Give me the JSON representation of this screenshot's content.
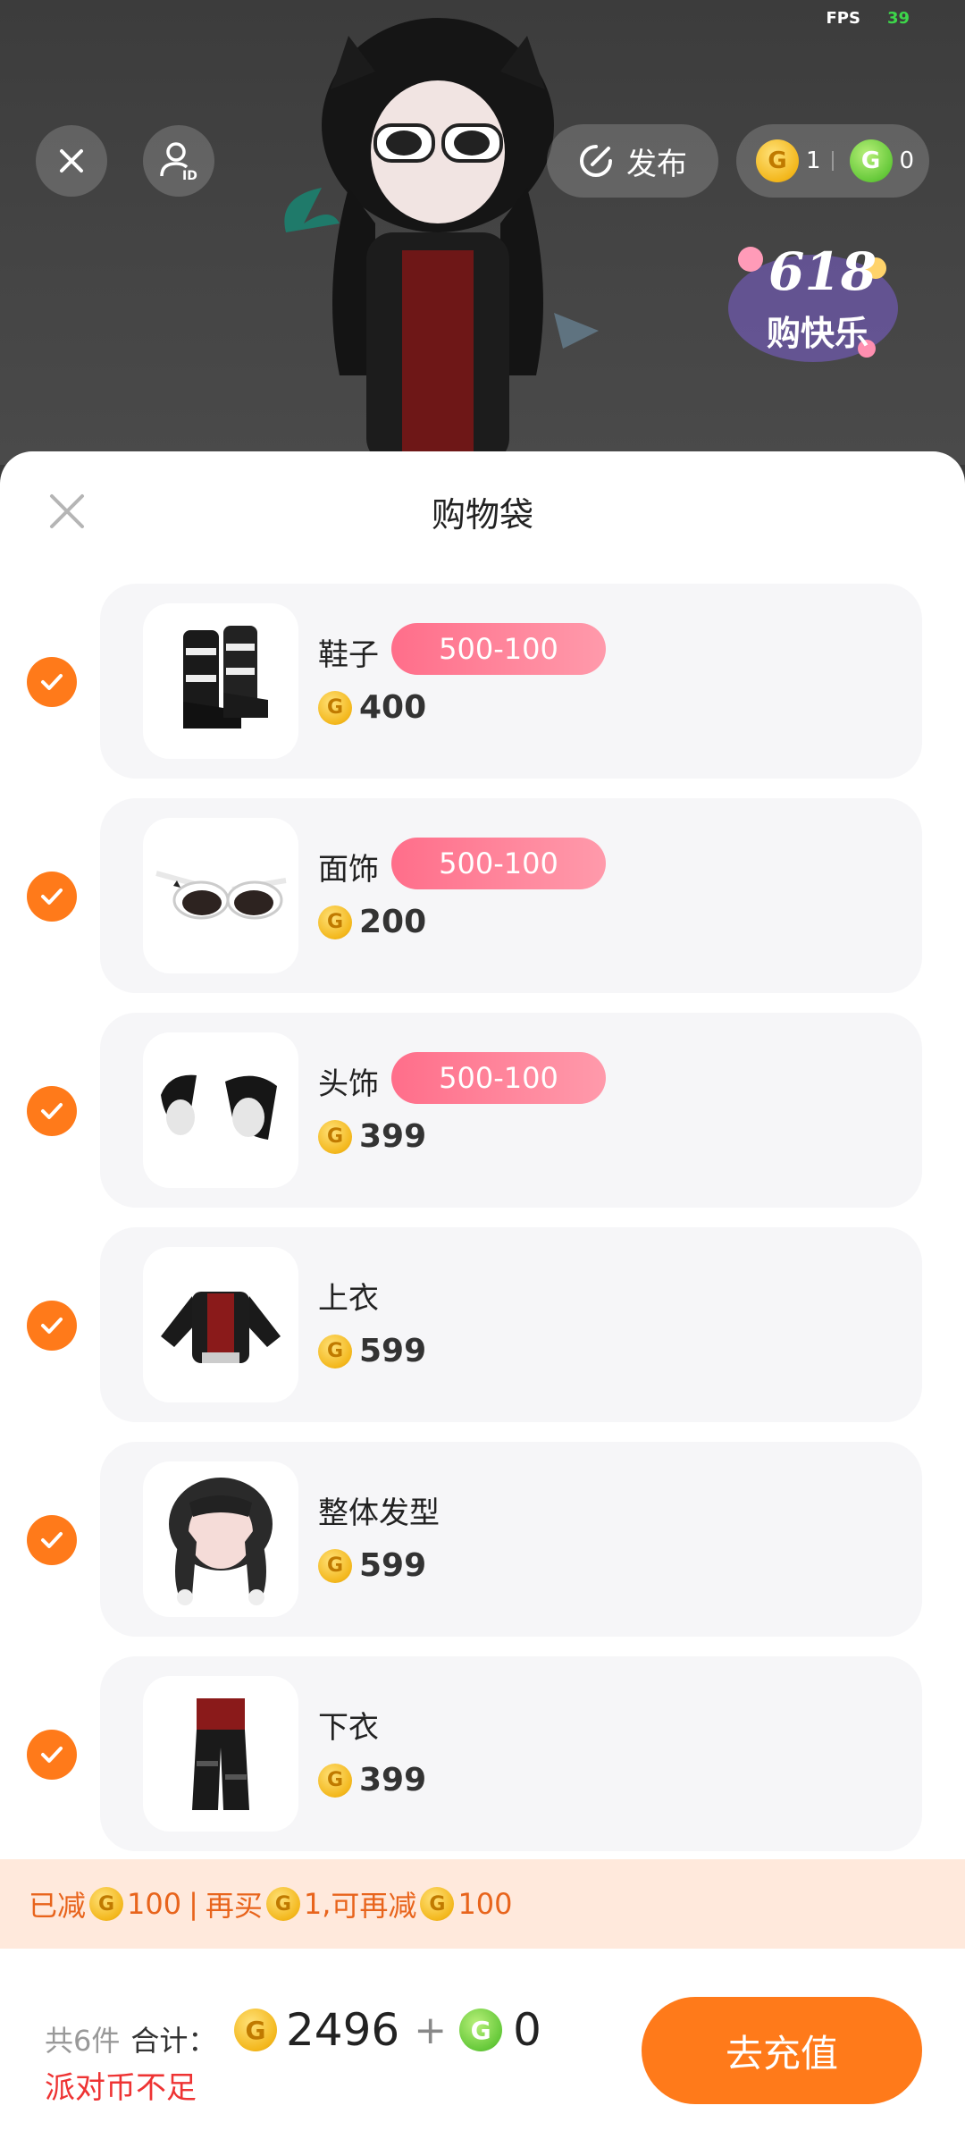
{
  "status": {
    "fps_label": "FPS",
    "fps_value": "39"
  },
  "top_bar": {
    "publish_label": "发布",
    "gold_coin_count": "1",
    "green_coin_count": "0",
    "promo_text_top": "618",
    "promo_text_bottom": "购快乐"
  },
  "sheet": {
    "title": "购物袋"
  },
  "items": [
    {
      "name": "鞋子",
      "tag": "500-100",
      "price": "400",
      "checked": true,
      "icon": "boots-icon"
    },
    {
      "name": "面饰",
      "tag": "500-100",
      "price": "200",
      "checked": true,
      "icon": "sunglasses-icon"
    },
    {
      "name": "头饰",
      "tag": "500-100",
      "price": "399",
      "checked": true,
      "icon": "ear-muffs-icon"
    },
    {
      "name": "上衣",
      "tag": "",
      "price": "599",
      "checked": true,
      "icon": "jacket-icon"
    },
    {
      "name": "整体发型",
      "tag": "",
      "price": "599",
      "checked": true,
      "icon": "hairstyle-icon"
    },
    {
      "name": "下衣",
      "tag": "",
      "price": "399",
      "checked": true,
      "icon": "pants-icon"
    }
  ],
  "discount": {
    "reduced_label": "已减",
    "reduced_amount": "100",
    "separator": "|",
    "buy_more_label": "再买",
    "buy_more_amount": "1,",
    "can_reduce_label": "可再减",
    "can_reduce_amount": "100"
  },
  "footer": {
    "count_text": "共6件",
    "total_label": "合计：",
    "total_value": "2496",
    "plus": "+",
    "green_value": "0",
    "warning": "派对币不足",
    "recharge_label": "去充值"
  },
  "colors": {
    "accent": "#ff7a1a",
    "tag_pink": "#ff6e8a",
    "warning_red": "#ee3333",
    "discount_bg": "#ffe9dc"
  }
}
